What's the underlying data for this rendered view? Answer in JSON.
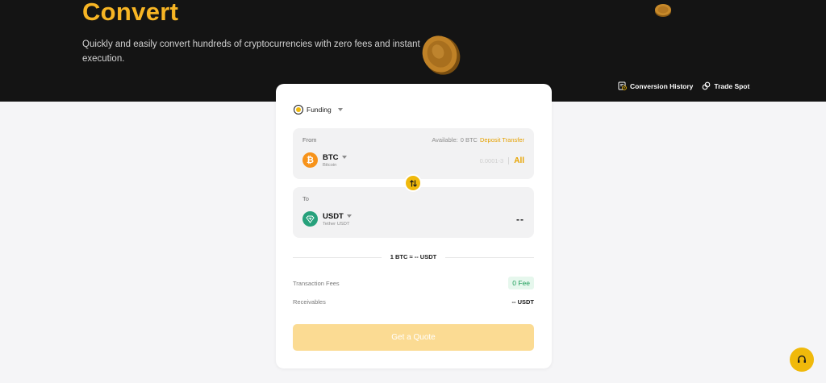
{
  "hero": {
    "title": "Convert",
    "subtitle": "Quickly and easily convert hundreds of cryptocurrencies with zero fees and instant execution."
  },
  "links": {
    "history": "Conversion History",
    "trade": "Trade Spot"
  },
  "card": {
    "wallet": {
      "label": "Funding"
    },
    "from": {
      "label": "From",
      "available_prefix": "Available:",
      "available_value": "0 BTC",
      "deposit_label": "Deposit Transfer",
      "asset": {
        "symbol": "BTC",
        "name": "Bitcoin",
        "icon": "bitcoin-icon",
        "color": "#f7931a"
      },
      "amount_placeholder": "0.0001-3",
      "all_label": "All"
    },
    "to": {
      "label": "To",
      "asset": {
        "symbol": "USDT",
        "name": "Tether USDT",
        "icon": "tether-icon",
        "color": "#26a17b"
      },
      "value": "--"
    },
    "rate": "1 BTC ≈ -- USDT",
    "fees": {
      "label": "Transaction Fees",
      "value": "0 Fee"
    },
    "receivables": {
      "label": "Receivables",
      "value": "-- USDT"
    },
    "quote_button": "Get a Quote"
  },
  "colors": {
    "accent": "#f0b90b",
    "hero_bg": "#141414",
    "title": "#f7b524",
    "fee_green": "#1e9e5a"
  }
}
